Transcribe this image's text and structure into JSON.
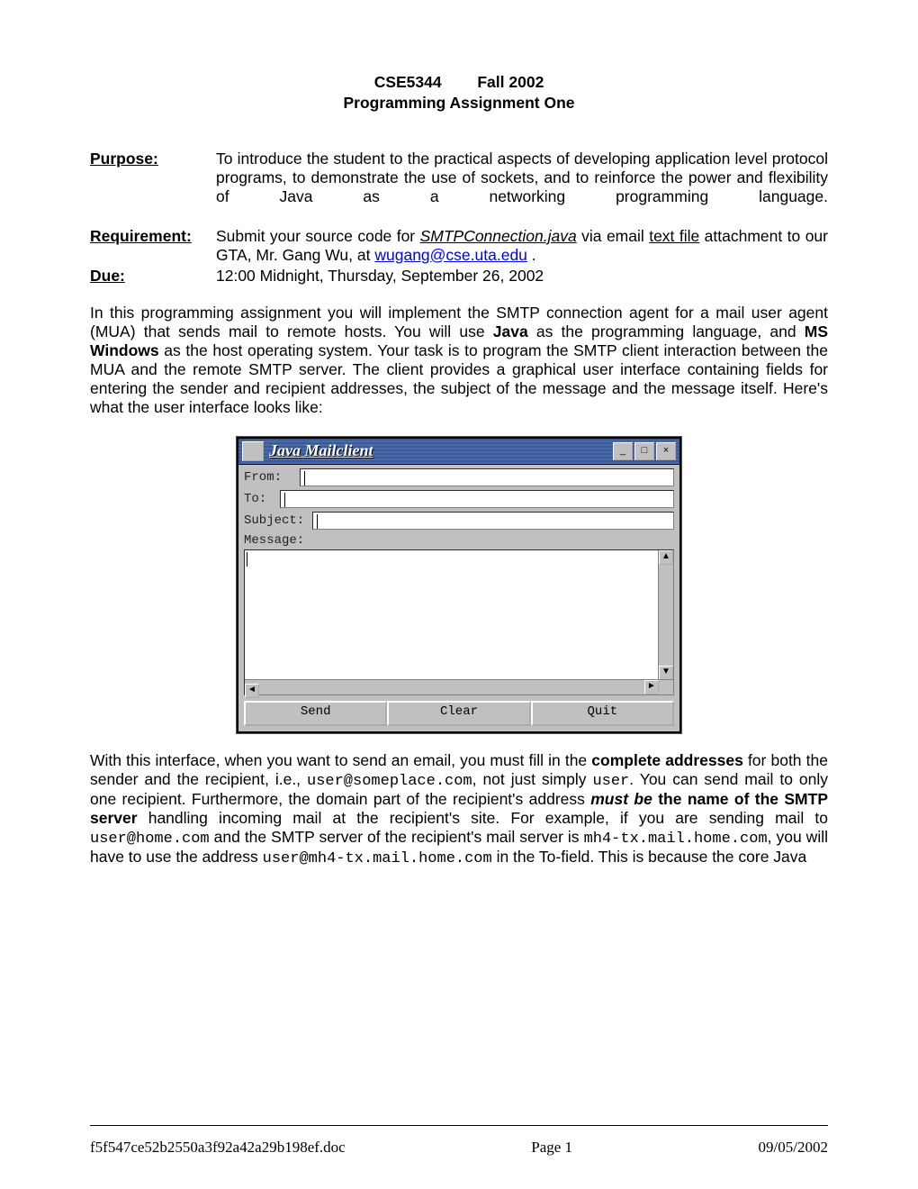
{
  "header": {
    "course": "CSE5344",
    "term": "Fall 2002",
    "subtitle": "Programming Assignment One"
  },
  "rows": {
    "purpose_label": "Purpose:",
    "purpose_text": "To introduce the student to the practical aspects of developing application level protocol programs, to demonstrate the use of sockets, and to reinforce the power and flexibility of Java as a networking programming language.",
    "requirement_label": "Requirement:",
    "requirement_pre": "Submit your source code for ",
    "requirement_file": "SMTPConnection.java",
    "requirement_mid": " via email ",
    "requirement_textfile": "text file",
    "requirement_line2_pre": " attachment to our GTA, Mr. Gang Wu, at ",
    "requirement_email": "wugang@cse.uta.edu",
    "requirement_line2_post": " .",
    "due_label": "Due:",
    "due_text": "12:00 Midnight, Thursday, September 26, 2002"
  },
  "para1": {
    "p1": "In this programming assignment you will implement the SMTP connection agent for a mail user agent (MUA) that sends mail to remote hosts. You will use ",
    "java": "Java",
    "p2": " as the programming language, and ",
    "mswin": "MS Windows",
    "p3": " as the host operating system.  Your task is to program the SMTP client interaction between the MUA and the remote SMTP server. The client provides a graphical user interface containing fields for entering the sender and recipient addresses, the subject of the message and the message itself. Here's what the user interface looks like:"
  },
  "mailclient": {
    "title": "Java Mailclient",
    "from_label": "From:",
    "to_label": "To:",
    "subject_label": "Subject:",
    "message_label": "Message:",
    "buttons": {
      "send": "Send",
      "clear": "Clear",
      "quit": "Quit"
    }
  },
  "para2": {
    "p1": "With this interface, when you want to send an email, you must fill in the ",
    "complete": "complete addresses",
    "p2": " for both the sender and the recipient, i.e., ",
    "addr1": "user@someplace.com",
    "p3": ", not just simply ",
    "addr2": "user",
    "p4": ". You can send mail to only one recipient. Furthermore, the domain part of the recipient's address ",
    "mustbe": "must be",
    "p5": " the name of the SMTP server",
    "p5b": " handling incoming mail at the recipient's site.  For example, if you are sending mail to ",
    "addr3": "user@home.com",
    "p6": " and the SMTP server of the recipient's mail server is ",
    "addr4": "mh4-tx.mail.home.com",
    "p7": ", you will have to use the address ",
    "addr5": "user@mh4-tx.mail.home.com",
    "p8": " in the To-field. This is because the core Java"
  },
  "footer": {
    "filename": "f5f547ce52b2550a3f92a42a29b198ef.doc",
    "page": "Page 1",
    "date": "09/05/2002"
  }
}
